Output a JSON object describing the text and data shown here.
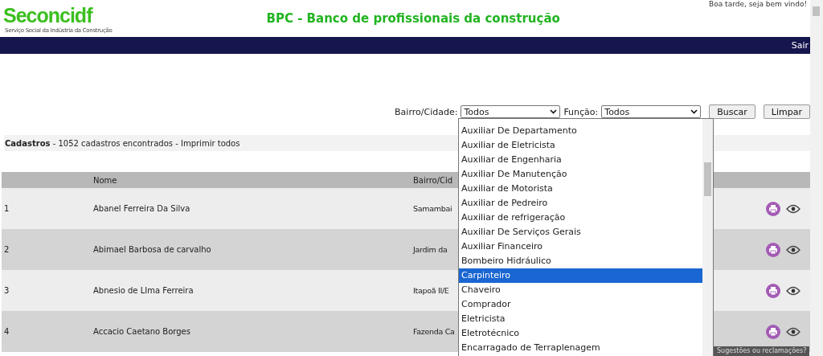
{
  "greeting": "Boa tarde, seja bem vindo!",
  "logo": {
    "name": "Seconcidf",
    "tagline": "Serviço Social da Indústria da Construção"
  },
  "title": "BPC - Banco de profissionais da construção",
  "nav": {
    "logout": "Sair"
  },
  "filters": {
    "city_label": "Bairro/Cidade:",
    "city_value": "Todos",
    "role_label": "Função:",
    "role_value": "Todos",
    "search_button": "Buscar",
    "clear_button": "Limpar"
  },
  "summary": {
    "title": "Cadastros",
    "count": " - 1052 cadastros encontrados - ",
    "print_all": "Imprimir todos"
  },
  "table": {
    "columns": [
      "Nome",
      "Bairro/Cid"
    ],
    "rows": [
      {
        "index": "1",
        "name": "Abanel Ferreira Da Silva",
        "city": "Samambai"
      },
      {
        "index": "2",
        "name": "Abimael Barbosa de carvalho",
        "city": "Jardim da"
      },
      {
        "index": "3",
        "name": "Abnesio de LIma Ferreira",
        "city": "Itapoã II/E"
      },
      {
        "index": "4",
        "name": "Accacio Caetano Borges",
        "city": "Fazenda Ca"
      }
    ]
  },
  "role_dropdown": {
    "options": [
      {
        "label": "Auxiliar De Departamento",
        "selected": false
      },
      {
        "label": "Auxiliar de Eletricista",
        "selected": false
      },
      {
        "label": "Auxiliar de Engenharia",
        "selected": false
      },
      {
        "label": "Auxiliar De Manutenção",
        "selected": false
      },
      {
        "label": "Auxiliar de Motorista",
        "selected": false
      },
      {
        "label": "Auxiliar de Pedreiro",
        "selected": false
      },
      {
        "label": "Auxiliar de refrigeração",
        "selected": false
      },
      {
        "label": "Auxiliar De Serviços Gerais",
        "selected": false
      },
      {
        "label": "Auxiliar Financeiro",
        "selected": false
      },
      {
        "label": "Bombeiro Hidráulico",
        "selected": false
      },
      {
        "label": "Carpinteiro",
        "selected": true
      },
      {
        "label": "Chaveiro",
        "selected": false
      },
      {
        "label": "Comprador",
        "selected": false
      },
      {
        "label": "Eletricista",
        "selected": false
      },
      {
        "label": "Eletrotécnico",
        "selected": false
      },
      {
        "label": "Encarragado de Terraplenagem",
        "selected": false
      }
    ]
  },
  "feedback_tab": "Sugestões ou reclamações?"
}
